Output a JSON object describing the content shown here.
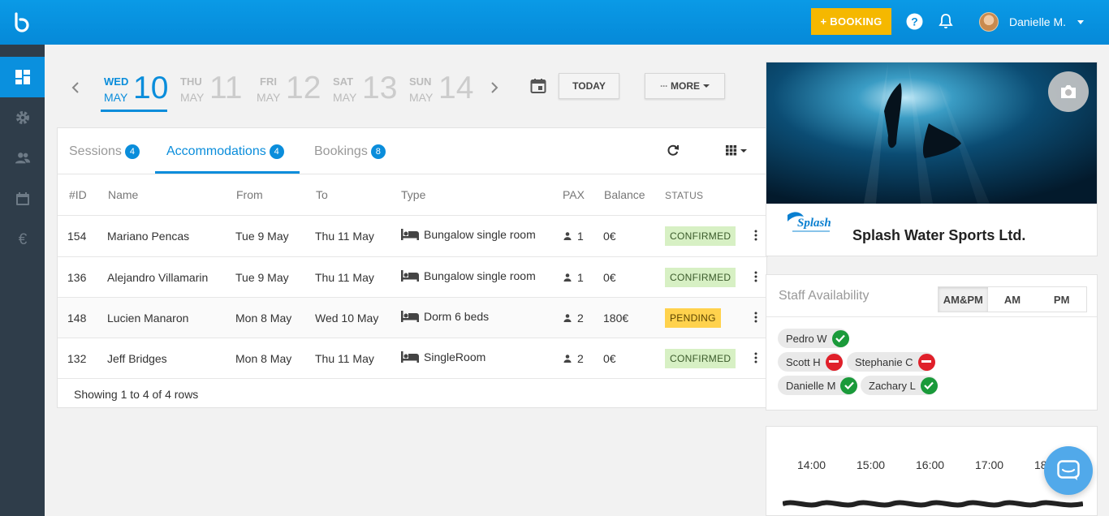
{
  "header": {
    "booking_button": "+ BOOKING",
    "user_name": "Danielle M.",
    "icons": [
      "logo-icon",
      "help-icon",
      "bell-icon",
      "avatar",
      "chevron-down-icon"
    ],
    "accent_color": "#0a8ddb",
    "booking_color": "#f5b800"
  },
  "sidebar": {
    "items": [
      {
        "name": "dashboard-icon",
        "active": true
      },
      {
        "name": "gear-icon",
        "active": false
      },
      {
        "name": "users-icon",
        "active": false
      },
      {
        "name": "calendar-icon",
        "active": false
      },
      {
        "name": "euro-icon",
        "active": false
      }
    ]
  },
  "dates": {
    "prev_icon": "chevron-left-icon",
    "next_icon": "chevron-right-icon",
    "days": [
      {
        "dow": "WED",
        "num": "10",
        "month": "MAY",
        "active": true
      },
      {
        "dow": "THU",
        "num": "11",
        "month": "MAY",
        "active": false
      },
      {
        "dow": "FRI",
        "num": "12",
        "month": "MAY",
        "active": false
      },
      {
        "dow": "SAT",
        "num": "13",
        "month": "MAY",
        "active": false
      },
      {
        "dow": "SUN",
        "num": "14",
        "month": "MAY",
        "active": false
      }
    ],
    "today_label": "TODAY",
    "more_label": "MORE"
  },
  "tabs": [
    {
      "label": "Sessions",
      "count": "4",
      "active": false
    },
    {
      "label": "Accommodations",
      "count": "4",
      "active": true
    },
    {
      "label": "Bookings",
      "count": "8",
      "active": false
    }
  ],
  "table": {
    "columns": {
      "id": "#ID",
      "name": "Name",
      "from": "From",
      "to": "To",
      "type": "Type",
      "pax": "PAX",
      "balance": "Balance",
      "status": "STATUS"
    },
    "rows": [
      {
        "id": "154",
        "name": "Mariano Pencas",
        "from": "Tue 9 May",
        "to": "Thu 11 May",
        "type": "Bungalow single room",
        "pax": "1",
        "balance": "0€",
        "status": "CONFIRMED"
      },
      {
        "id": "136",
        "name": "Alejandro Villamarin",
        "from": "Tue 9 May",
        "to": "Thu 11 May",
        "type": "Bungalow single room",
        "pax": "1",
        "balance": "0€",
        "status": "CONFIRMED"
      },
      {
        "id": "148",
        "name": "Lucien Manaron",
        "from": "Mon 8 May",
        "to": "Wed 10 May",
        "type": "Dorm 6 beds",
        "pax": "2",
        "balance": "180€",
        "status": "PENDING"
      },
      {
        "id": "132",
        "name": "Jeff Bridges",
        "from": "Mon 8 May",
        "to": "Thu 11 May",
        "type": "SingleRoom",
        "pax": "2",
        "balance": "0€",
        "status": "CONFIRMED"
      }
    ],
    "footer": "Showing 1 to 4 of 4 rows"
  },
  "company": {
    "name": "Splash Water Sports Ltd.",
    "logo_text": "Splash"
  },
  "staff": {
    "title": "Staff Availability",
    "filters": [
      {
        "label": "AM&PM",
        "active": true
      },
      {
        "label": "AM",
        "active": false
      },
      {
        "label": "PM",
        "active": false
      }
    ],
    "members": [
      {
        "name": "Pedro W",
        "available": true
      },
      {
        "name": "Scott H",
        "available": false
      },
      {
        "name": "Stephanie C",
        "available": false
      },
      {
        "name": "Danielle M",
        "available": true
      },
      {
        "name": "Zachary L",
        "available": true
      }
    ]
  },
  "timeline": {
    "hours": [
      "14:00",
      "15:00",
      "16:00",
      "17:00",
      "18"
    ]
  }
}
